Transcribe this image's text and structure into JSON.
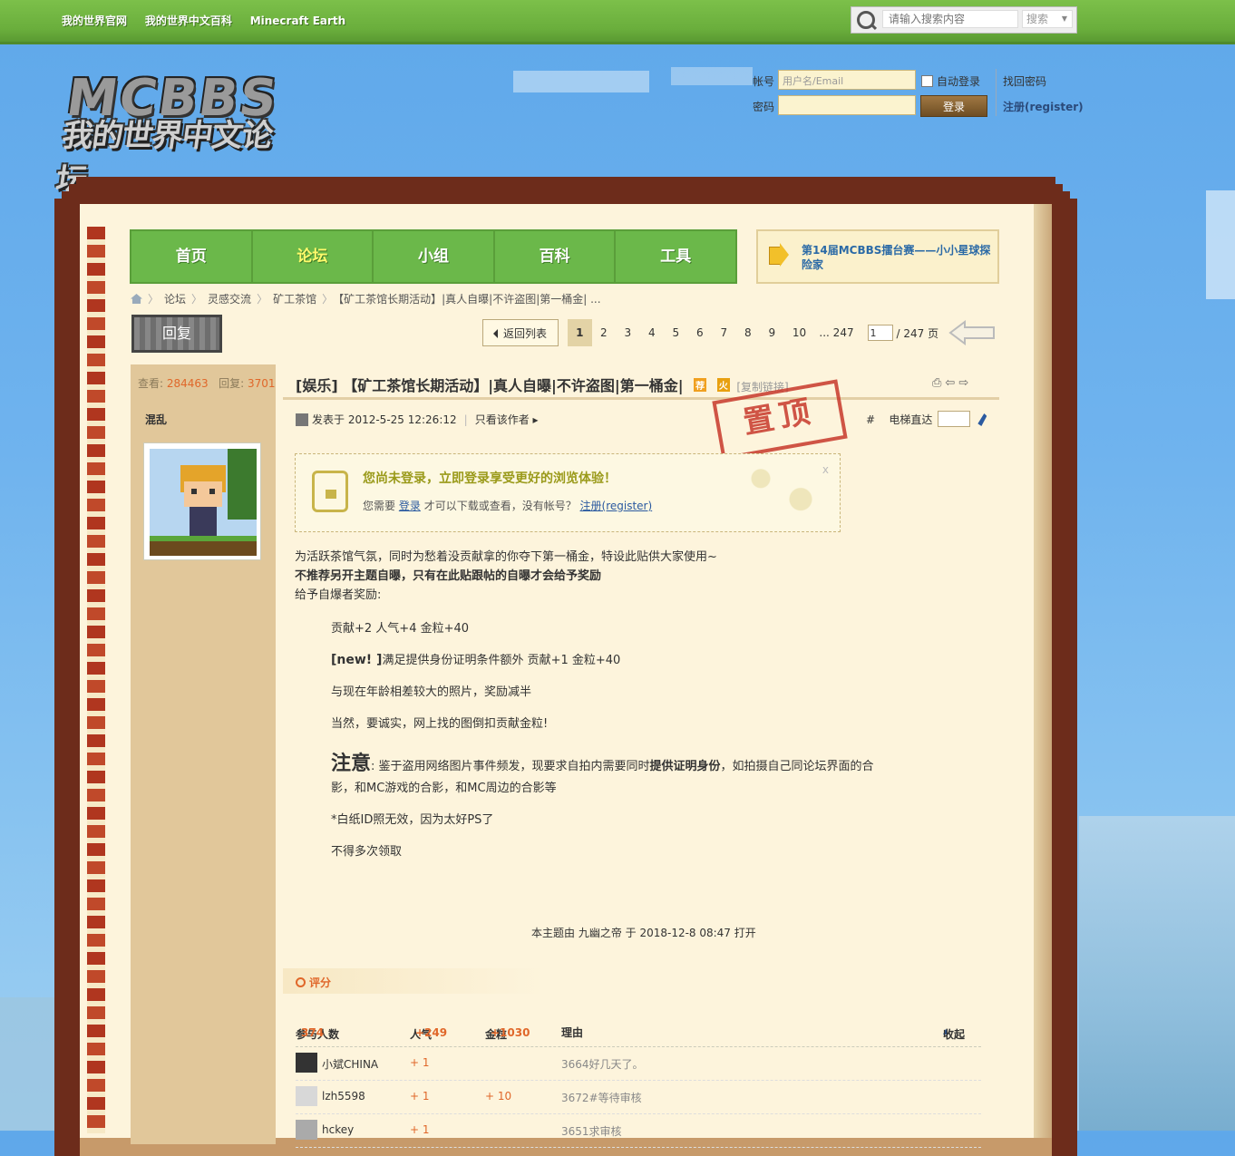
{
  "topbar": {
    "links": [
      "我的世界官网",
      "我的世界中文百科",
      "Minecraft Earth"
    ],
    "search_placeholder": "请输入搜索内容",
    "search_type": "搜索"
  },
  "logo": {
    "line1": "MCBBS",
    "line2": "我的世界中文论坛"
  },
  "login": {
    "account_label": "帐号",
    "account_placeholder": "用户名/Email",
    "auto_login": "自动登录",
    "find_password": "找回密码",
    "password_label": "密码",
    "login_button": "登录",
    "register": "注册(register)"
  },
  "nav": {
    "items": [
      "首页",
      "论坛",
      "小组",
      "百科",
      "工具"
    ],
    "active": "论坛"
  },
  "notice": {
    "text": "第14届MCBBS擂台赛——小小星球探险家"
  },
  "breadcrumb": [
    "论坛",
    "灵感交流",
    "矿工茶馆",
    "【矿工茶馆长期活动】|真人自曝|不许盗图|第一桶金| ..."
  ],
  "reply_button": "回复",
  "pager": {
    "back": "返回列表",
    "pages": [
      "1",
      "2",
      "3",
      "4",
      "5",
      "6",
      "7",
      "8",
      "9",
      "10",
      "... 247"
    ],
    "current": "1",
    "input_value": "1",
    "total": "/ 247 页"
  },
  "thread": {
    "views_label": "查看:",
    "views": "284463",
    "replies_label": "回复:",
    "replies": "3701",
    "author": "混乱",
    "title": "[娱乐] 【矿工茶馆长期活动】|真人自曝|不许盗图|第一桶金|",
    "badge_recommend": "荐",
    "badge_hot": "火",
    "copy_link": "[复制链接]",
    "posted": "发表于 2012-5-25 12:26:12",
    "only_author": "只看该作者",
    "stamp": "置顶",
    "floor_mark": "#",
    "elevator": "电梯直达"
  },
  "login_prompt": {
    "headline": "您尚未登录，立即登录享受更好的浏览体验！",
    "text_before": "您需要",
    "login_link": "登录",
    "text_middle": "才可以下载或查看，没有帐号？",
    "register_link": "注册(register)",
    "close": "x"
  },
  "content": {
    "p1": "为活跃茶馆气氛，同时为愁着没贡献拿的你夺下第一桶金，特设此贴供大家使用~",
    "p2": "不推荐另开主题自曝，只有在此贴跟帖的自曝才会给予奖励",
    "p3": "给予自爆者奖励:",
    "l1": "贡献+2  人气+4 金粒+40",
    "l2_bold": "[new! ]",
    "l2_rest": "满足提供身份证明条件额外 贡献+1 金粒+40",
    "l3": "与现在年龄相差较大的照片，奖励减半",
    "l4": "当然，要诚实，网上找的图倒扣贡献金粒!",
    "l5_big": "注意",
    "l5_a": ": 鉴于盗用网络图片事件频发，现要求自拍内需要同时",
    "l5_bold": "提供证明身份",
    "l5_b": "，如拍摄自己同论坛界面的合",
    "l5_c": "影，和MC游戏的合影，和MC周边的合影等",
    "l6": "*白纸ID照无效，因为太好PS了",
    "l7": "不得多次领取",
    "closed": "本主题由 九幽之帝 于 2018-12-8 08:47 打开"
  },
  "rating": {
    "title": "评分",
    "participants_label": "参与人数",
    "participants": "374",
    "pop_label": "人气",
    "pop": "+249",
    "gold_label": "金粒",
    "gold": "+1030",
    "reason_label": "理由",
    "collapse": "收起",
    "rows": [
      {
        "user": "小斌CHINA",
        "pop": "+ 1",
        "gold": "",
        "reason": "3664好几天了。"
      },
      {
        "user": "lzh5598",
        "pop": "+ 1",
        "gold": "+ 10",
        "reason": "3672#等待审核"
      },
      {
        "user": "hckey",
        "pop": "+ 1",
        "gold": "",
        "reason": "3651求审核"
      }
    ]
  }
}
